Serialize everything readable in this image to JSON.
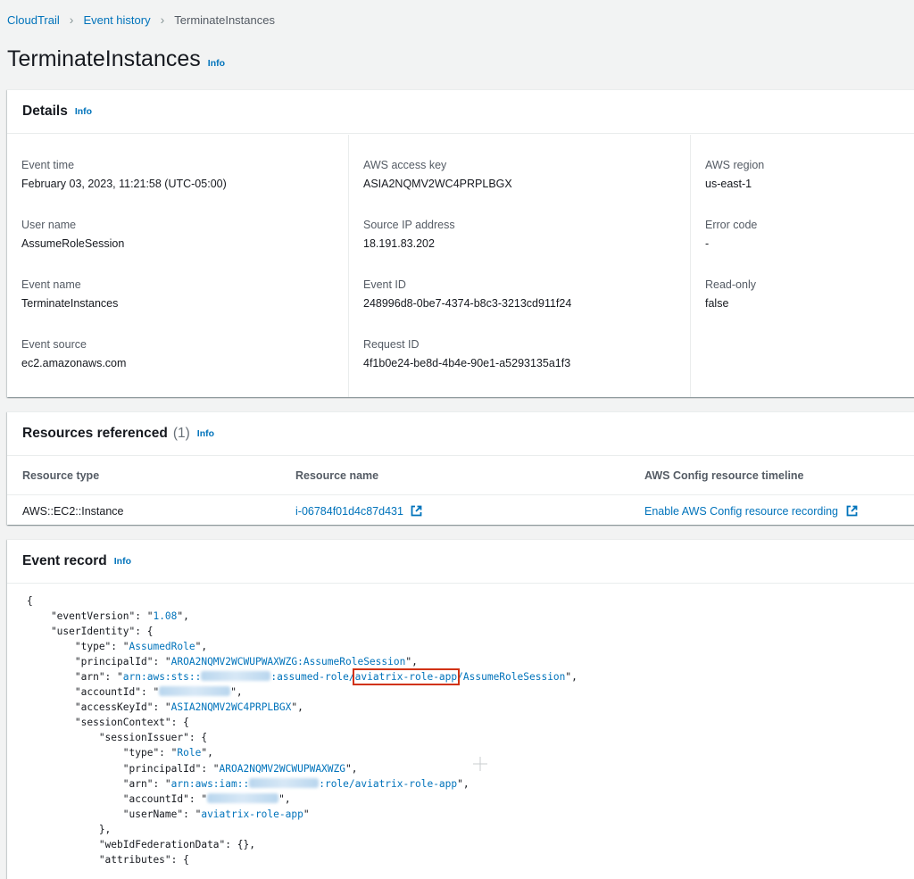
{
  "breadcrumb": {
    "items": [
      "CloudTrail",
      "Event history"
    ],
    "current": "TerminateInstances"
  },
  "page": {
    "title": "TerminateInstances",
    "info_label": "Info"
  },
  "details": {
    "title": "Details",
    "info_label": "Info",
    "col1": [
      {
        "label": "Event time",
        "value": "February 03, 2023, 11:21:58 (UTC-05:00)"
      },
      {
        "label": "User name",
        "value": "AssumeRoleSession"
      },
      {
        "label": "Event name",
        "value": "TerminateInstances"
      },
      {
        "label": "Event source",
        "value": "ec2.amazonaws.com"
      }
    ],
    "col2": [
      {
        "label": "AWS access key",
        "value": "ASIA2NQMV2WC4PRPLBGX"
      },
      {
        "label": "Source IP address",
        "value": "18.191.83.202"
      },
      {
        "label": "Event ID",
        "value": "248996d8-0be7-4374-b8c3-3213cd911f24"
      },
      {
        "label": "Request ID",
        "value": "4f1b0e24-be8d-4b4e-90e1-a5293135a1f3"
      }
    ],
    "col3": [
      {
        "label": "AWS region",
        "value": "us-east-1"
      },
      {
        "label": "Error code",
        "value": "-"
      },
      {
        "label": "Read-only",
        "value": "false"
      }
    ]
  },
  "resources": {
    "title": "Resources referenced",
    "count": "(1)",
    "info_label": "Info",
    "headers": [
      "Resource type",
      "Resource name",
      "AWS Config resource timeline"
    ],
    "rows": [
      {
        "type": "AWS::EC2::Instance",
        "name": "i-06784f01d4c87d431",
        "timeline": "Enable AWS Config resource recording"
      }
    ]
  },
  "record": {
    "title": "Event record",
    "info_label": "Info",
    "json": {
      "eventVersion": "1.08",
      "userIdentity": {
        "type": "AssumedRole",
        "principalId": "AROA2NQMV2WCWUPWAXWZG:AssumeRoleSession",
        "arn_prefix": "arn:aws:sts::",
        "arn_mid": ":assumed-role/",
        "arn_role": "aviatrix-role-app",
        "arn_suffix": "/AssumeRoleSession",
        "accessKeyId": "ASIA2NQMV2WC4PRPLBGX",
        "sessionIssuer": {
          "type": "Role",
          "principalId": "AROA2NQMV2WCWUPWAXWZG",
          "arn_prefix": "arn:aws:iam::",
          "arn_suffix": ":role/aviatrix-role-app",
          "userName": "aviatrix-role-app"
        },
        "webIdFederationData": "{}"
      }
    }
  }
}
